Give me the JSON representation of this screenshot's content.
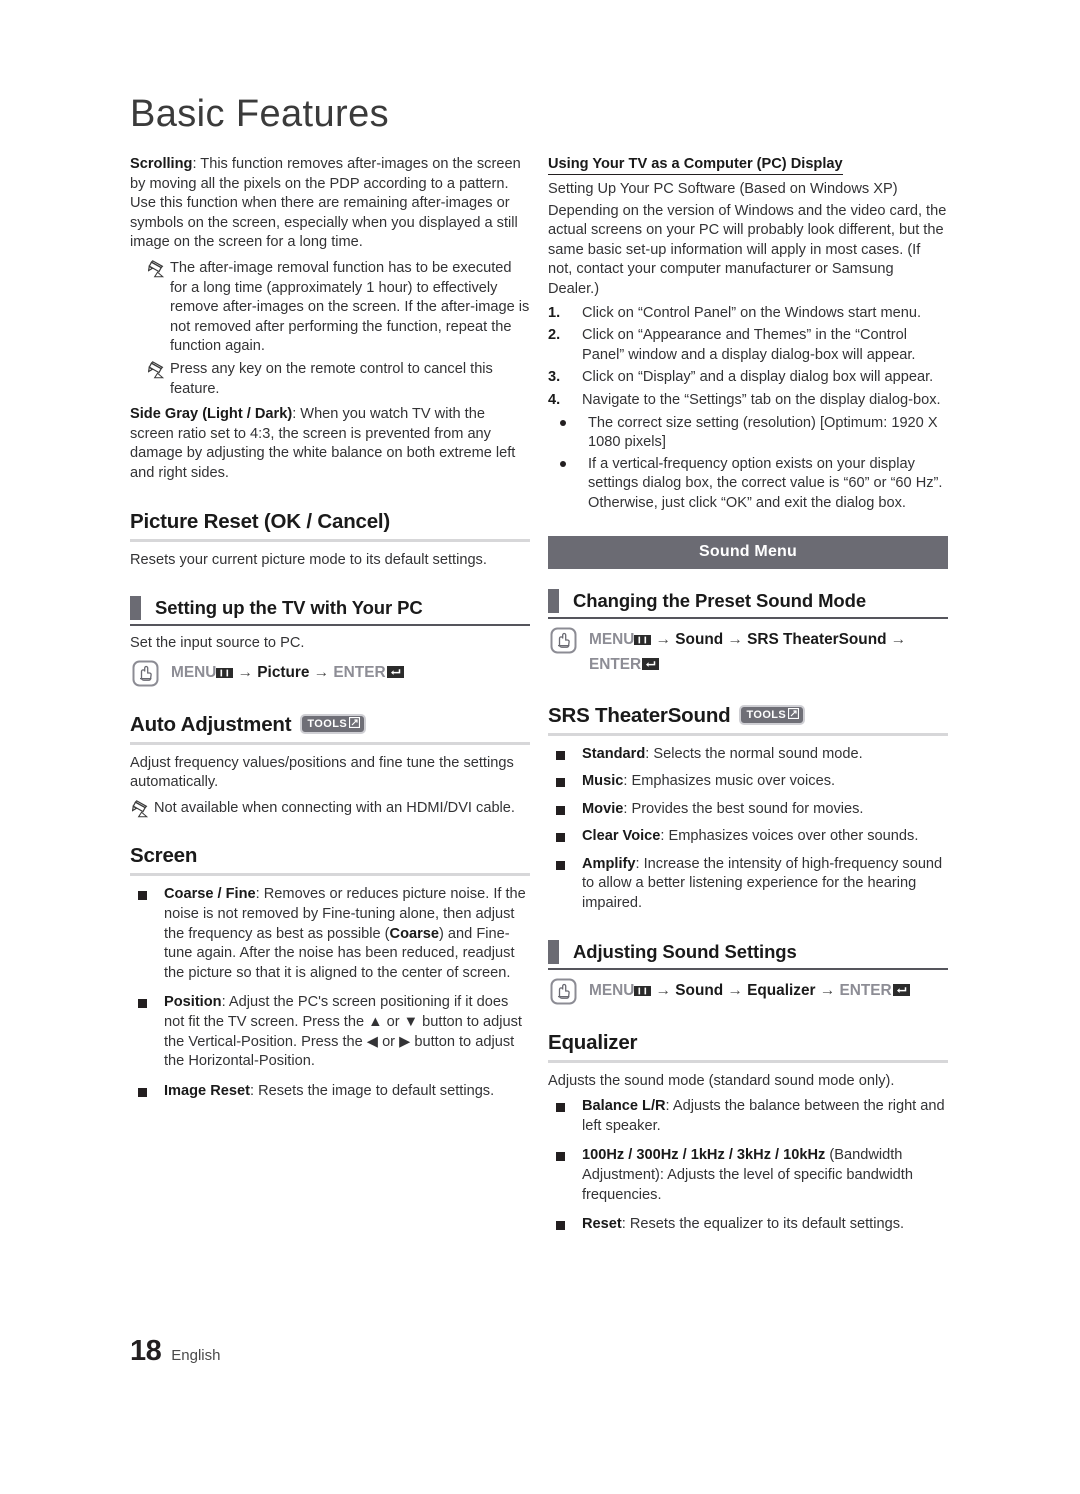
{
  "page": {
    "title": "Basic Features",
    "footer_page_number": "18",
    "footer_language": "English"
  },
  "colors": {
    "banner_bg": "#6b6b73",
    "marker_block": "#6b6b73",
    "rule_light": "#d7d7d9",
    "rule_dark": "#55555c",
    "text": "#333335",
    "tools_badge_bg": "#6f6f77"
  },
  "icons": {
    "menu": "menu-hand-icon",
    "menu_grid": "menu-grid-icon",
    "enter": "enter-key-icon",
    "tools_label": "TOOLS",
    "tools_arrow": "tools-arrow-icon",
    "note": "pencil-note-icon",
    "arrow_right": "→",
    "arrow_up": "▲",
    "arrow_down": "▼",
    "arrow_left_tri": "◀",
    "arrow_right_tri": "▶"
  },
  "left_column": {
    "scrolling": {
      "term": "Scrolling",
      "text": ": This function removes after-images on the screen by moving all the pixels on the PDP according to a pattern. Use this function when there are remaining after-images or symbols on the screen, especially when you displayed a still image on the screen for a long time."
    },
    "notes": [
      "The after-image removal function has to be executed for a long time (approximately 1 hour) to effectively remove after-images on the screen. If the after-image is not removed after performing the function, repeat the function again.",
      "Press any key on the remote control to cancel this feature."
    ],
    "side_gray": {
      "term": "Side Gray (Light / Dark)",
      "text": ": When you watch TV with the screen ratio set to 4:3, the screen is prevented from any damage by adjusting the white balance on both extreme left and right sides."
    },
    "picture_reset": {
      "heading": "Picture Reset (OK / Cancel)",
      "body": "Resets your current picture mode to its default settings."
    },
    "setting_up_tv_pc": {
      "heading": "Setting up the TV with Your PC",
      "body": "Set the input source to PC.",
      "path": {
        "menu": "MENU",
        "step1": "Picture",
        "enter": "ENTER"
      }
    },
    "auto_adjustment": {
      "heading": "Auto Adjustment",
      "has_tools_badge": true,
      "body": "Adjust frequency values/positions and fine tune the settings automatically.",
      "note": "Not available when connecting with an HDMI/DVI cable."
    },
    "screen": {
      "heading": "Screen",
      "items": [
        {
          "term": "Coarse / Fine",
          "text": ": Removes or reduces picture noise. If the noise is not removed by Fine-tuning alone, then adjust the frequency as best as possible (",
          "term2": "Coarse",
          "text2": ") and Fine-tune again. After the noise has been reduced, readjust the picture so that it is aligned to the center of screen."
        },
        {
          "term": "Position",
          "text": ": Adjust the PC's screen positioning if it does not fit the TV screen. Press the ▲ or ▼ button to adjust the Vertical-Position. Press the ◀ or ▶ button to adjust the Horizontal-Position."
        },
        {
          "term": "Image Reset",
          "text": ": Resets the image to default settings."
        }
      ]
    }
  },
  "right_column": {
    "pc_display": {
      "heading": "Using Your TV as a Computer (PC) Display",
      "line1": "Setting Up Your PC Software (Based on Windows XP)",
      "line2": "Depending on the version of Windows and the video card, the actual screens on your PC will probably look different, but the same basic set-up information will apply in most cases. (If not, contact your computer manufacturer or Samsung Dealer.)",
      "steps": [
        {
          "n": "1.",
          "text": "Click on “Control Panel” on the Windows start menu."
        },
        {
          "n": "2.",
          "text": "Click on “Appearance and Themes” in the “Control Panel” window and a display dialog-box will appear."
        },
        {
          "n": "3.",
          "text": "Click on “Display” and a display dialog box will appear."
        },
        {
          "n": "4.",
          "text": "Navigate to the “Settings” tab on the display dialog-box."
        }
      ],
      "bullets": [
        "The correct size setting (resolution) [Optimum: 1920 X 1080 pixels]",
        "If a vertical-frequency option exists on your display settings dialog box, the correct value is “60” or “60 Hz”. Otherwise, just click “OK” and exit the dialog box."
      ]
    },
    "sound_menu_banner": "Sound Menu",
    "changing_preset_sound_mode": {
      "heading": "Changing the Preset Sound Mode",
      "path": {
        "menu": "MENU",
        "step1": "Sound",
        "step2": "SRS TheaterSound",
        "enter": "ENTER"
      }
    },
    "srs_theatersound": {
      "heading": "SRS TheaterSound",
      "has_tools_badge": true,
      "items": [
        {
          "term": "Standard",
          "text": ": Selects the normal sound mode."
        },
        {
          "term": "Music",
          "text": ": Emphasizes music over voices."
        },
        {
          "term": "Movie",
          "text": ": Provides the best sound for movies."
        },
        {
          "term": "Clear Voice",
          "text": ": Emphasizes voices over other sounds."
        },
        {
          "term": "Amplify",
          "text": ": Increase the intensity of high-frequency sound to allow a better listening experience for the hearing impaired."
        }
      ]
    },
    "adjusting_sound_settings": {
      "heading": "Adjusting Sound Settings",
      "path": {
        "menu": "MENU",
        "step1": "Sound",
        "step2": "Equalizer",
        "enter": "ENTER"
      }
    },
    "equalizer": {
      "heading": "Equalizer",
      "body": "Adjusts the sound mode (standard sound mode only).",
      "items": [
        {
          "term": "Balance L/R",
          "text": ": Adjusts the balance between the right and left speaker."
        },
        {
          "term": "100Hz / 300Hz / 1kHz / 3kHz / 10kHz",
          "text": " (Bandwidth Adjustment): Adjusts the level of specific bandwidth frequencies."
        },
        {
          "term": "Reset",
          "text": ": Resets the equalizer to its default settings."
        }
      ]
    }
  }
}
